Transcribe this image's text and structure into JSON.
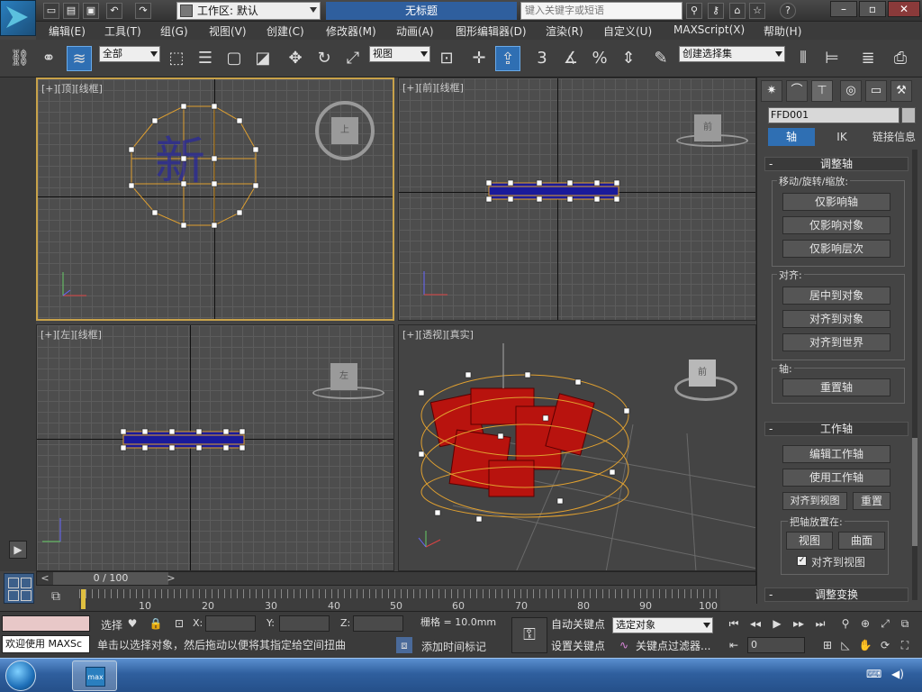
{
  "titlebar": {
    "workspace_label": "工作区: 默认",
    "doc_title": "无标题",
    "search_placeholder": "键入关键字或短语",
    "help_icon": "?"
  },
  "menu": [
    "编辑(E)",
    "工具(T)",
    "组(G)",
    "视图(V)",
    "创建(C)",
    "修改器(M)",
    "动画(A)",
    "图形编辑器(D)",
    "渲染(R)",
    "自定义(U)",
    "MAXScript(X)",
    "帮助(H)"
  ],
  "toolbar": {
    "filter_select": "全部",
    "ref_coord_select": "视图",
    "snap_value": "3",
    "named_selection": "创建选择集"
  },
  "viewports": {
    "top": {
      "label": "[+][顶][线框]"
    },
    "front": {
      "label": "[+][前][线框]",
      "cube_text": "前"
    },
    "left": {
      "label": "[+][左][线框]",
      "cube_text": "左"
    },
    "persp": {
      "label": "[+][透视][真实]",
      "cube_text": "前"
    },
    "top_cube_text": "上"
  },
  "command_panel": {
    "object_name": "FFD001",
    "tabs": [
      "轴",
      "IK",
      "链接信息"
    ],
    "rollout_adjust_pivot": "调整轴",
    "group_move_label": "移动/旋转/缩放:",
    "btn_affect_pivot_only": "仅影响轴",
    "btn_affect_object_only": "仅影响对象",
    "btn_affect_hierarchy_only": "仅影响层次",
    "group_align_label": "对齐:",
    "btn_center_to_object": "居中到对象",
    "btn_align_to_object": "对齐到对象",
    "btn_align_to_world": "对齐到世界",
    "group_pivot_label": "轴:",
    "btn_reset_pivot": "重置轴",
    "rollout_working_pivot": "工作轴",
    "btn_edit_working_pivot": "编辑工作轴",
    "btn_use_working_pivot": "使用工作轴",
    "btn_align_to_view": "对齐到视图",
    "btn_reset": "重置",
    "group_place_pivot_label": "把轴放置在:",
    "btn_view": "视图",
    "btn_surface": "曲面",
    "check_align_to_view": "对齐到视图",
    "rollout_adjust_transform": "调整变换"
  },
  "timeline": {
    "frame_counter": "0 / 100",
    "ticks": [
      "10",
      "20",
      "30",
      "40",
      "50",
      "60",
      "70",
      "80",
      "90",
      "100"
    ]
  },
  "status": {
    "welcome_text": "欢迎使用 MAXSc",
    "selection_label": "选择",
    "x_label": "X:",
    "y_label": "Y:",
    "z_label": "Z:",
    "grid_label": "栅格 = 10.0mm",
    "prompt_text": "单击以选择对象，然后拖动以便将其指定给空间扭曲",
    "add_time_tag": "添加时间标记",
    "auto_key": "自动关键点",
    "set_key": "设置关键点",
    "key_mode_select": "选定对象",
    "key_filters": "关键点过滤器...",
    "current_frame": "0"
  }
}
